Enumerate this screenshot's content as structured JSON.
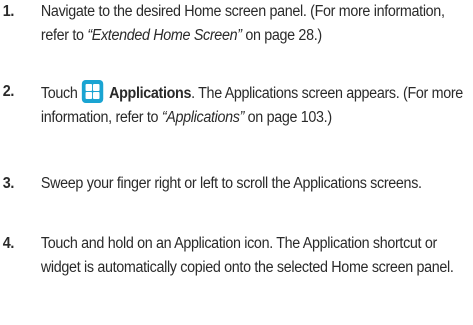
{
  "steps": [
    {
      "number": "1.",
      "text_a": "Navigate to the desired Home screen panel. (For more information, refer to ",
      "ref_title": "“Extended Home Screen”",
      "text_b": " on page 28.)"
    },
    {
      "number": "2.",
      "text_a": "Touch",
      "icon": "applications-icon",
      "bold_label": "Applications",
      "text_b": ". The Applications screen appears. (For more information, refer to ",
      "ref_title": "“Applications”",
      "text_c": " on page 103.)"
    },
    {
      "number": "3.",
      "text_a": "Sweep your finger right or left to scroll the Applications screens."
    },
    {
      "number": "4.",
      "text_a": "Touch and hold on an Application icon. The Application shortcut or widget is automatically copied onto the selected Home screen panel."
    }
  ],
  "colors": {
    "text": "#2a2a2a",
    "icon_bg": "#1aa4d2"
  }
}
